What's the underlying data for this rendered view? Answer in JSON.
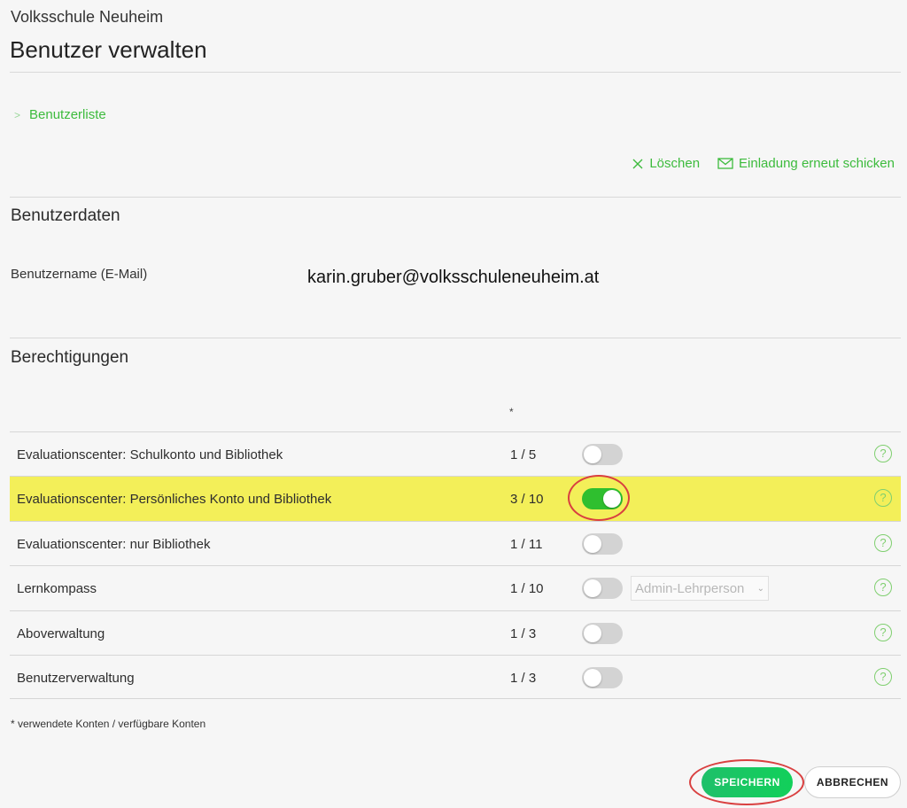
{
  "header": {
    "school": "Volksschule Neuheim",
    "title": "Benutzer verwalten"
  },
  "breadcrumb": {
    "label": "Benutzerliste"
  },
  "actions": {
    "delete_label": "Löschen",
    "resend_label": "Einladung erneut schicken"
  },
  "user_data": {
    "heading": "Benutzerdaten",
    "username_label": "Benutzername (E-Mail)",
    "username_value": "karin.gruber@volksschuleneuheim.at"
  },
  "permissions": {
    "heading": "Berechtigungen",
    "count_header": "*",
    "rows": [
      {
        "name": "Evaluationscenter: Schulkonto und Bibliothek",
        "count": "1 / 5",
        "enabled": false
      },
      {
        "name": "Evaluationscenter: Persönliches Konto und Bibliothek",
        "count": "3 / 10",
        "enabled": true
      },
      {
        "name": "Evaluationscenter: nur Bibliothek",
        "count": "1 / 11",
        "enabled": false
      },
      {
        "name": "Lernkompass",
        "count": "1 / 10",
        "enabled": false,
        "role_select": "Admin-Lehrperson"
      },
      {
        "name": "Aboverwaltung",
        "count": "1 / 3",
        "enabled": false
      },
      {
        "name": "Benutzerverwaltung",
        "count": "1 / 3",
        "enabled": false
      }
    ],
    "help_symbol": "?",
    "footnote": "* verwendete Konten / verfügbare Konten"
  },
  "buttons": {
    "save_label": "SPEICHERN",
    "cancel_label": "ABBRECHEN"
  },
  "colors": {
    "accent_green": "#3dbb3d",
    "highlight_yellow": "#f3ef59",
    "annotation_red": "#d94040"
  }
}
